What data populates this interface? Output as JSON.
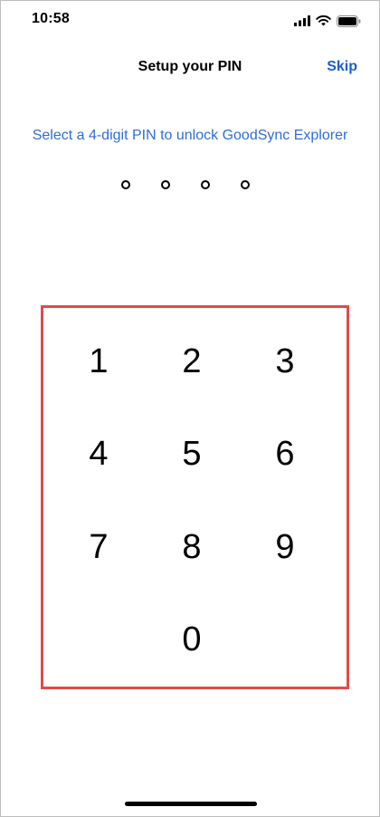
{
  "status_bar": {
    "time": "10:58",
    "icons": [
      "cellular-signal-icon",
      "wifi-icon",
      "battery-icon"
    ]
  },
  "nav": {
    "title": "Setup your PIN",
    "skip_label": "Skip"
  },
  "instruction": "Select a 4-digit PIN to unlock GoodSync Explorer",
  "pin": {
    "length": 4,
    "entered": 0
  },
  "keypad": {
    "keys": [
      "1",
      "2",
      "3",
      "4",
      "5",
      "6",
      "7",
      "8",
      "9",
      "0"
    ]
  },
  "colors": {
    "accent": "#1a5fd0",
    "instruction_text": "#2f6dd8",
    "highlight_border": "#e24a4a"
  }
}
